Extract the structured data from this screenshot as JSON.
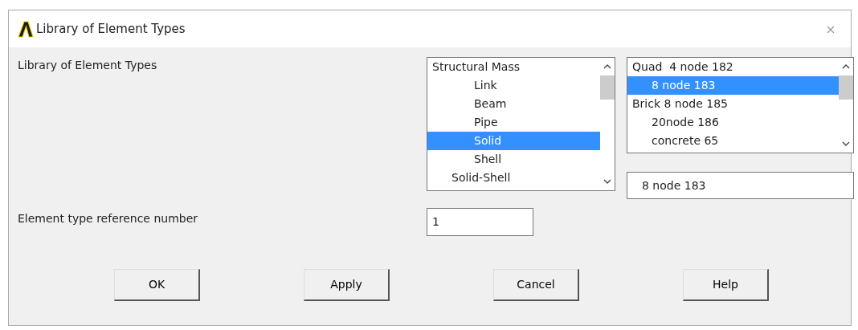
{
  "window": {
    "title": "Library of Element Types"
  },
  "library_label": "Library of Element Types",
  "category_list": [
    {
      "label": "Structural Mass",
      "kind": "group",
      "selected": false,
      "children": [
        {
          "label": "Link",
          "selected": false
        },
        {
          "label": "Beam",
          "selected": false
        },
        {
          "label": "Pipe",
          "selected": false
        },
        {
          "label": "Solid",
          "selected": true
        },
        {
          "label": "Shell",
          "selected": false
        }
      ]
    },
    {
      "label": "Solid-Shell",
      "kind": "entry",
      "selected": false
    }
  ],
  "type_list": [
    {
      "label": "Quad  4 node 182",
      "kind": "group",
      "selected": false,
      "children": [
        {
          "label": "8 node 183",
          "selected": true
        }
      ]
    },
    {
      "label": "Brick 8 node 185",
      "kind": "group",
      "selected": false,
      "children": [
        {
          "label": "20node 186",
          "selected": false
        },
        {
          "label": "concrete 65",
          "selected": false
        }
      ]
    }
  ],
  "selected_type_field": {
    "value": "8 node 183"
  },
  "reference_number": {
    "label": "Element type reference number",
    "value": "1"
  },
  "buttons": [
    "OK",
    "Apply",
    "Cancel",
    "Help"
  ]
}
